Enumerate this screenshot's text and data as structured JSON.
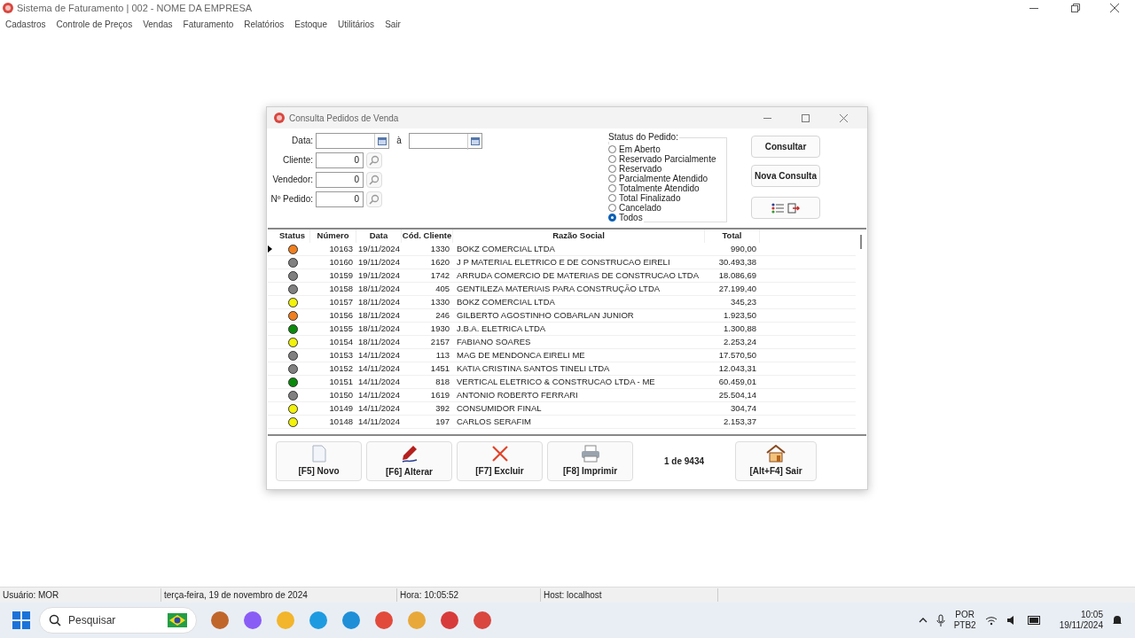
{
  "window": {
    "title": "Sistema de Faturamento | 002 - NOME DA EMPRESA"
  },
  "menu": [
    "Cadastros",
    "Controle de Preços",
    "Vendas",
    "Faturamento",
    "Relatórios",
    "Estoque",
    "Utilitários",
    "Sair"
  ],
  "dialog": {
    "title": "Consulta Pedidos de Venda",
    "filters": {
      "data_label": "Data:",
      "data_sep": "à",
      "fields": [
        {
          "label": "Cliente:",
          "value": "0"
        },
        {
          "label": "Vendedor:",
          "value": "0"
        },
        {
          "label": "Nº Pedido:",
          "value": "0"
        }
      ]
    },
    "status_group": {
      "label": "Status do Pedido:",
      "options": [
        {
          "label": "Em Aberto",
          "selected": false
        },
        {
          "label": "Reservado Parcialmente",
          "selected": false
        },
        {
          "label": "Reservado",
          "selected": false
        },
        {
          "label": "Parcialmente Atendido",
          "selected": false
        },
        {
          "label": "Totalmente Atendido",
          "selected": false
        },
        {
          "label": "Total Finalizado",
          "selected": false
        },
        {
          "label": "Cancelado",
          "selected": false
        },
        {
          "label": "Todos",
          "selected": true
        }
      ]
    },
    "actions": [
      "Consultar",
      "Nova Consulta"
    ],
    "table": {
      "columns": [
        "Status",
        "Número",
        "Data",
        "Cód. Cliente",
        "Razão Social",
        "Total"
      ],
      "rows": [
        {
          "current": true,
          "color": "#f07f1f",
          "numero": "10163",
          "data": "19/11/2024",
          "cod": "1330",
          "razao": "BOKZ COMERCIAL LTDA",
          "total": "990,00"
        },
        {
          "current": false,
          "color": "#808080",
          "numero": "10160",
          "data": "19/11/2024",
          "cod": "1620",
          "razao": "J P MATERIAL ELETRICO E DE CONSTRUCAO EIRELI",
          "total": "30.493,38"
        },
        {
          "current": false,
          "color": "#808080",
          "numero": "10159",
          "data": "19/11/2024",
          "cod": "1742",
          "razao": "ARRUDA COMERCIO DE MATERIAS DE CONSTRUCAO LTDA",
          "total": "18.086,69"
        },
        {
          "current": false,
          "color": "#808080",
          "numero": "10158",
          "data": "18/11/2024",
          "cod": "405",
          "razao": "GENTILEZA MATERIAIS PARA CONSTRUÇÃO LTDA",
          "total": "27.199,40"
        },
        {
          "current": false,
          "color": "#f2f20a",
          "numero": "10157",
          "data": "18/11/2024",
          "cod": "1330",
          "razao": "BOKZ COMERCIAL LTDA",
          "total": "345,23"
        },
        {
          "current": false,
          "color": "#f07f1f",
          "numero": "10156",
          "data": "18/11/2024",
          "cod": "246",
          "razao": "GILBERTO AGOSTINHO COBARLAN JUNIOR",
          "total": "1.923,50"
        },
        {
          "current": false,
          "color": "#0a8a0a",
          "numero": "10155",
          "data": "18/11/2024",
          "cod": "1930",
          "razao": "J.B.A. ELETRICA LTDA",
          "total": "1.300,88"
        },
        {
          "current": false,
          "color": "#f2f20a",
          "numero": "10154",
          "data": "18/11/2024",
          "cod": "2157",
          "razao": "FABIANO SOARES",
          "total": "2.253,24"
        },
        {
          "current": false,
          "color": "#808080",
          "numero": "10153",
          "data": "14/11/2024",
          "cod": "113",
          "razao": "MAG DE MENDONCA EIRELI ME",
          "total": "17.570,50"
        },
        {
          "current": false,
          "color": "#808080",
          "numero": "10152",
          "data": "14/11/2024",
          "cod": "1451",
          "razao": "KATIA CRISTINA SANTOS TINELI LTDA",
          "total": "12.043,31"
        },
        {
          "current": false,
          "color": "#0a8a0a",
          "numero": "10151",
          "data": "14/11/2024",
          "cod": "818",
          "razao": "VERTICAL ELETRICO & CONSTRUCAO LTDA - ME",
          "total": "60.459,01"
        },
        {
          "current": false,
          "color": "#808080",
          "numero": "10150",
          "data": "14/11/2024",
          "cod": "1619",
          "razao": "ANTONIO ROBERTO FERRARI",
          "total": "25.504,14"
        },
        {
          "current": false,
          "color": "#f2f20a",
          "numero": "10149",
          "data": "14/11/2024",
          "cod": "392",
          "razao": "CONSUMIDOR FINAL",
          "total": "304,74"
        },
        {
          "current": false,
          "color": "#f2f20a",
          "numero": "10148",
          "data": "14/11/2024",
          "cod": "197",
          "razao": "CARLOS SERAFIM",
          "total": "2.153,37"
        }
      ]
    },
    "toolbar": [
      {
        "kind": "new",
        "label": "[F5] Novo"
      },
      {
        "kind": "edit",
        "label": "[F6] Alterar"
      },
      {
        "kind": "delete",
        "label": "[F7] Excluir"
      },
      {
        "kind": "print",
        "label": "[F8] Imprimir"
      }
    ],
    "record_count": "1 de 9434",
    "exit_button": "[Alt+F4] Sair"
  },
  "status_bar": [
    "Usuário: MOR",
    "terça-feira, 19 de novembro de 2024",
    "Hora: 10:05:52",
    "Host: localhost"
  ],
  "taskbar": {
    "search": "Pesquisar",
    "language": "POR",
    "layout": "PTB2",
    "time": "10:05",
    "date": "19/11/2024"
  }
}
